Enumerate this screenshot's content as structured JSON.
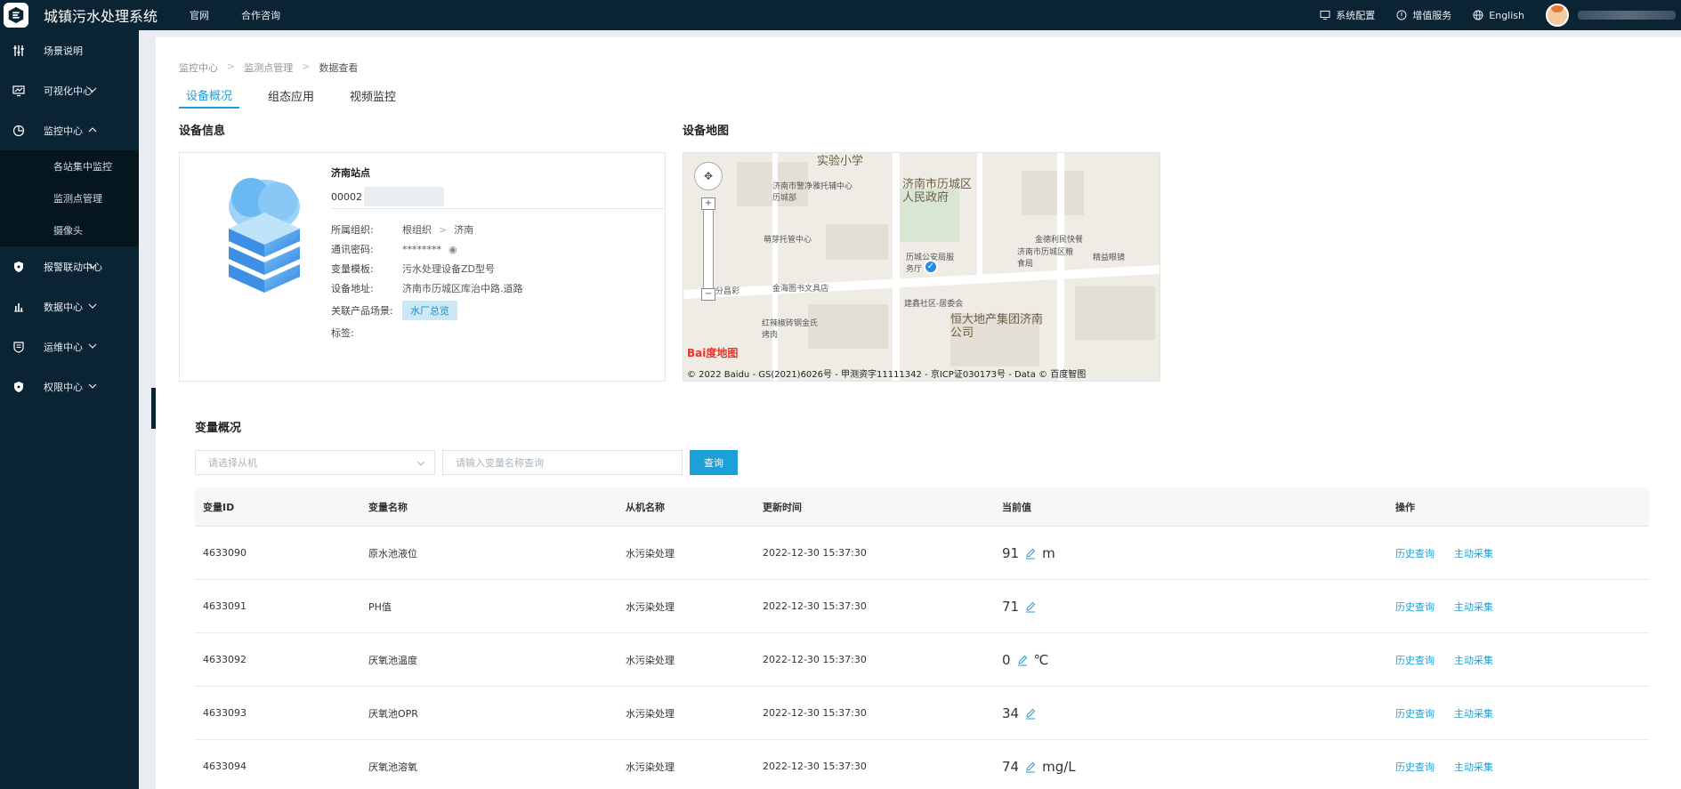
{
  "app": {
    "title": "城镇污水处理系统"
  },
  "top_nav": [
    "官网",
    "合作咨询"
  ],
  "top_right": {
    "system_config": "系统配置",
    "value_added": "增值服务",
    "language": "English"
  },
  "sidebar": {
    "items": [
      {
        "label": "场景说明"
      },
      {
        "label": "可视化中心"
      },
      {
        "label": "监控中心"
      },
      {
        "label": "报警联动中心"
      },
      {
        "label": "数据中心"
      },
      {
        "label": "运维中心"
      },
      {
        "label": "权限中心"
      }
    ],
    "submenu": [
      "各站集中监控",
      "监测点管理",
      "摄像头"
    ]
  },
  "breadcrumb": [
    "监控中心",
    "监测点管理",
    "数据查看"
  ],
  "tabs": [
    "设备概况",
    "组态应用",
    "视频监控"
  ],
  "device_info": {
    "heading": "设备信息",
    "name": "济南站点",
    "id_prefix": "00002",
    "fields": [
      {
        "k": "所属组织:",
        "v": "根组织",
        "v2": "济南"
      },
      {
        "k": "通讯密码:",
        "v": "********"
      },
      {
        "k": "变量模板:",
        "v": "污水处理设备ZD型号"
      },
      {
        "k": "设备地址:",
        "v": "济南市历城区库治中路.道路"
      },
      {
        "k": "关联产品场景:",
        "v": "水厂总览"
      },
      {
        "k": "标签:",
        "v": ""
      }
    ]
  },
  "map": {
    "heading": "设备地图",
    "labels": [
      "实验小学",
      "济南市警净雅托辅中心历城部",
      "济南市历城区人民政府",
      "萌芽托管中心",
      "金德利民快餐",
      "济南市历城区粮食局",
      "精益眼镜",
      "历城公安局服务厅",
      "金海图书文具店",
      "分昌彩",
      "建鑫社区-居委会",
      "红辣椒砖钢金氏烤肉",
      "恒大地产集团济南公司"
    ],
    "copyright": "© 2022 Baidu - GS(2021)6026号 - 甲测资字11111342 - 京ICP证030173号 - Data © 百度智图",
    "logo": "Bai度地图"
  },
  "variables": {
    "heading": "变量概况",
    "select_placeholder": "请选择从机",
    "input_placeholder": "请输入变量名称查询",
    "query_button": "查询",
    "columns": [
      "变量ID",
      "变量名称",
      "从机名称",
      "更新时间",
      "当前值",
      "操作"
    ],
    "rows": [
      {
        "id": "4633090",
        "name": "原水池液位",
        "slave": "水污染处理",
        "time": "2022-12-30 15:37:30",
        "value": "91",
        "unit": "m"
      },
      {
        "id": "4633091",
        "name": "PH值",
        "slave": "水污染处理",
        "time": "2022-12-30 15:37:30",
        "value": "71",
        "unit": ""
      },
      {
        "id": "4633092",
        "name": "厌氧池温度",
        "slave": "水污染处理",
        "time": "2022-12-30 15:37:30",
        "value": "0",
        "unit": "℃"
      },
      {
        "id": "4633093",
        "name": "厌氧池OPR",
        "slave": "水污染处理",
        "time": "2022-12-30 15:37:30",
        "value": "34",
        "unit": ""
      },
      {
        "id": "4633094",
        "name": "厌氧池溶氧",
        "slave": "水污染处理",
        "time": "2022-12-30 15:37:30",
        "value": "74",
        "unit": "mg/L"
      }
    ],
    "actions": [
      "历史查询",
      "主动采集"
    ]
  },
  "colors": {
    "accent": "#1ba0d8",
    "sidebar_bg": "#0b2433"
  }
}
